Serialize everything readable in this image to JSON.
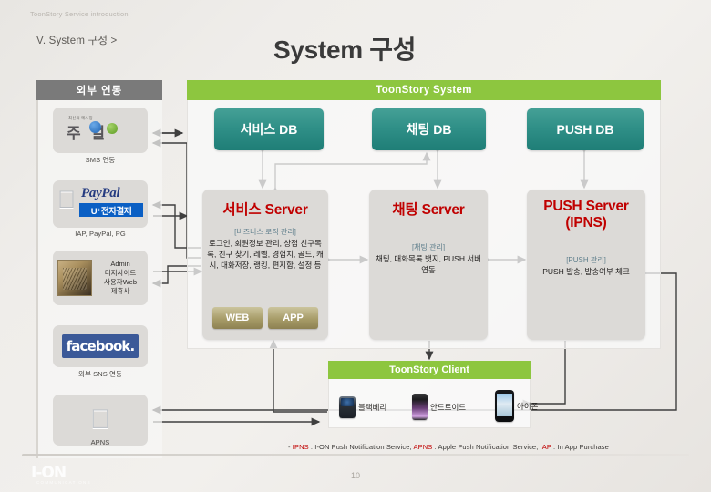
{
  "slide": {
    "header_label": "ToonStory Service introduction",
    "breadcrumb": "V. System 구성 >",
    "title": "System 구성",
    "page_number": "10",
    "footnote_prefix": "- ",
    "footnote_ipns_key": "IPNS",
    "footnote_ipns_val": " : I-ON Push Notification Service,  ",
    "footnote_apns_key": "APNS",
    "footnote_apns_val": " : Apple Push Notification Service,  ",
    "footnote_iap_key": "IAP",
    "footnote_iap_val": " : In App Purchase",
    "brand": "I-ON",
    "brand_sub": "COMMUNICATIONS"
  },
  "external": {
    "header": "외부 연동",
    "cards": [
      {
        "id": "sms",
        "caption": "SMS 연동",
        "logo_top": "최신의 메시징",
        "logo_main": "주  얼"
      },
      {
        "id": "pay",
        "caption": "IAP, PayPal, PG",
        "paypal": "PayPal",
        "uplus": "U⁺전자결제"
      },
      {
        "id": "admin",
        "caption": "",
        "lines": [
          "Admin",
          "티저사이트",
          "사용자Web",
          "제휴사"
        ]
      },
      {
        "id": "fb",
        "caption": "외부 SNS 연동",
        "logo": "facebook."
      },
      {
        "id": "apns",
        "caption": "APNS"
      }
    ]
  },
  "system": {
    "header": "ToonStory System",
    "databases": [
      {
        "name": "서비스 DB"
      },
      {
        "name": "채팅 DB"
      },
      {
        "name": "PUSH DB"
      }
    ],
    "servers": [
      {
        "title": "서비스 Server",
        "subtitle": "[비즈니스 로직 관리]",
        "body": "로그인, 회원정보 관리, 상점 친구목록, 친구 찾기, 레벨, 경험치, 골드, 캐시, 대화저장, 랭킹, 편지함, 설정 등",
        "pills": [
          "WEB",
          "APP"
        ]
      },
      {
        "title": "채팅 Server",
        "subtitle": "[채팅 관리]",
        "body": "채팅, 대화목록 뱃지, PUSH 서버 연동"
      },
      {
        "title": "PUSH Server (IPNS)",
        "title_line1": "PUSH Server",
        "title_line2": "(IPNS)",
        "subtitle": "[PUSH 관리]",
        "body": "PUSH 발송, 발송여부 체크"
      }
    ]
  },
  "client": {
    "header": "ToonStory Client",
    "devices": [
      {
        "label": "블랙베리"
      },
      {
        "label": "안드로이드"
      },
      {
        "label": "아이폰"
      }
    ]
  },
  "colors": {
    "accent_green": "#8dc63f",
    "db_teal": "#2e8e86",
    "server_title_red": "#c00000",
    "external_gray": "#7a7a7a"
  }
}
